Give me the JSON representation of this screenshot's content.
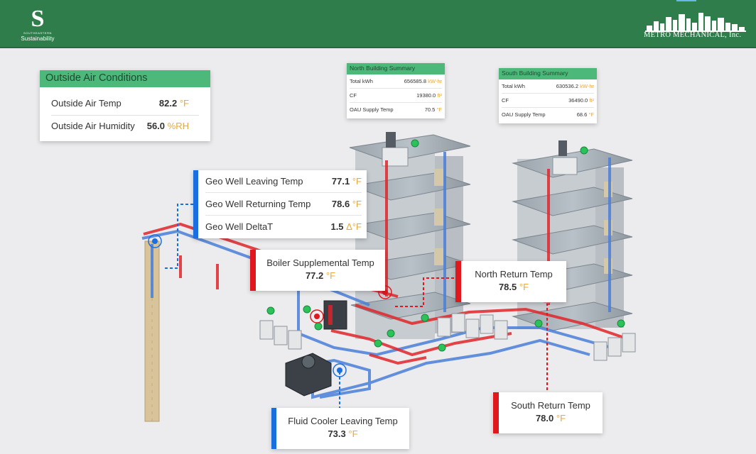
{
  "header": {
    "logo_small_text": "SOUTHEASTERN",
    "logo_name": "Sustainability",
    "company": "METRO MECHANICAL, Inc."
  },
  "outside_air": {
    "title": "Outside Air Conditions",
    "rows": [
      {
        "label": "Outside Air Temp",
        "value": "82.2",
        "unit": "°F"
      },
      {
        "label": "Outside Air Humidity",
        "value": "56.0",
        "unit": "%RH"
      }
    ]
  },
  "north_summary": {
    "title": "North Building Summary",
    "rows": [
      {
        "label": "Total kWh",
        "value": "656585.8",
        "unit": "kW-hr"
      },
      {
        "label": "CF",
        "value": "19380.0",
        "unit": "ft²"
      },
      {
        "label": "OAU Supply Temp",
        "value": "70.5",
        "unit": "°F"
      }
    ]
  },
  "south_summary": {
    "title": "South Building Summary",
    "rows": [
      {
        "label": "Total kWh",
        "value": "630536.2",
        "unit": "kW-hr"
      },
      {
        "label": "CF",
        "value": "36490.0",
        "unit": "ft²"
      },
      {
        "label": "OAU Supply Temp",
        "value": "68.6",
        "unit": "°F"
      }
    ]
  },
  "geo_well": {
    "rows": [
      {
        "label": "Geo Well Leaving Temp",
        "value": "77.1",
        "unit": "°F"
      },
      {
        "label": "Geo Well Returning Temp",
        "value": "78.6",
        "unit": "°F"
      },
      {
        "label": "Geo Well DeltaT",
        "value": "1.5",
        "unit": "Δ°F"
      }
    ]
  },
  "boiler": {
    "label": "Boiler Supplemental Temp",
    "value": "77.2",
    "unit": "°F"
  },
  "north_return": {
    "label": "North Return Temp",
    "value": "78.5",
    "unit": "°F"
  },
  "south_return": {
    "label": "South Return Temp",
    "value": "78.0",
    "unit": "°F"
  },
  "fluid_cooler": {
    "label": "Fluid Cooler Leaving Temp",
    "value": "73.3",
    "unit": "°F"
  },
  "colors": {
    "header": "#2e7d4a",
    "card_header": "#4cb879",
    "supply_red": "#e0181e",
    "return_blue": "#1a6fe0",
    "unit_amber": "#e9a83a"
  }
}
